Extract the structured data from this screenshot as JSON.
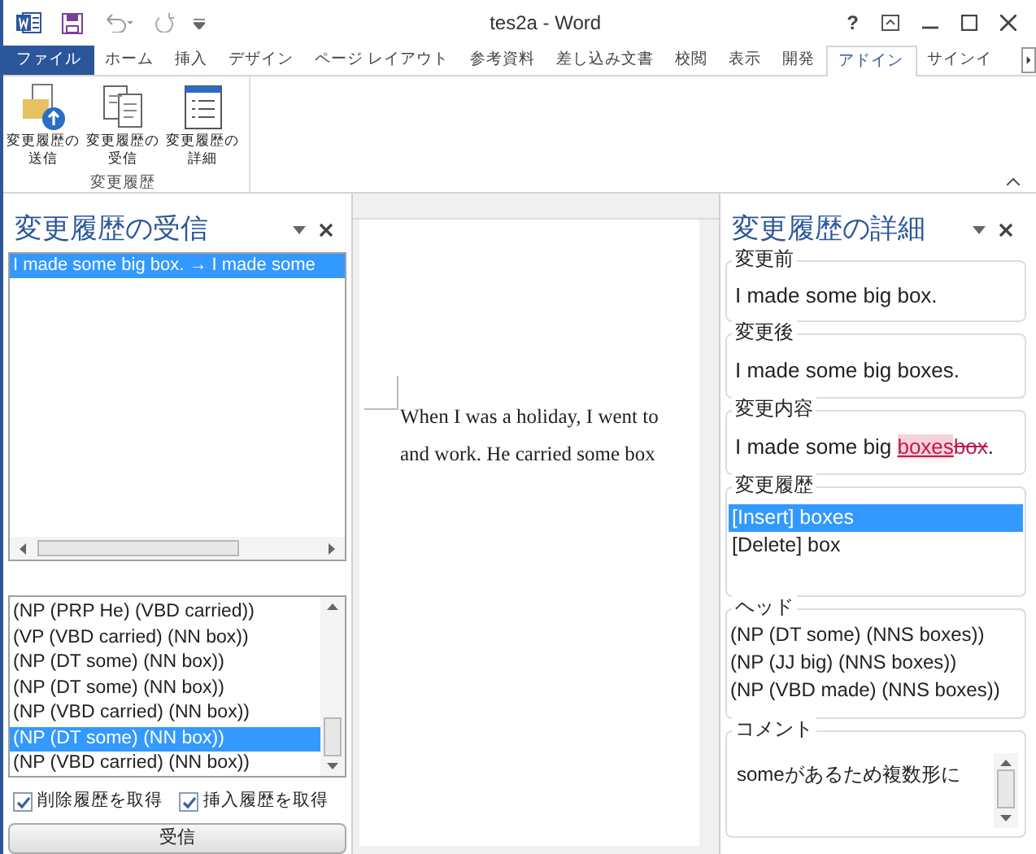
{
  "window": {
    "title": "tes2a - Word",
    "help": "?"
  },
  "ribbon_tabs": [
    {
      "label": "ファイル",
      "kind": "file",
      "selected": false
    },
    {
      "label": "ホーム",
      "kind": "tab",
      "selected": false
    },
    {
      "label": "挿入",
      "kind": "tab",
      "selected": false
    },
    {
      "label": "デザイン",
      "kind": "tab",
      "selected": false
    },
    {
      "label": "ページ レイアウト",
      "kind": "tab",
      "selected": false
    },
    {
      "label": "参考資料",
      "kind": "tab",
      "selected": false
    },
    {
      "label": "差し込み文書",
      "kind": "tab",
      "selected": false
    },
    {
      "label": "校閲",
      "kind": "tab",
      "selected": false
    },
    {
      "label": "表示",
      "kind": "tab",
      "selected": false
    },
    {
      "label": "開発",
      "kind": "tab",
      "selected": false
    },
    {
      "label": "アドイン",
      "kind": "tab",
      "selected": true
    },
    {
      "label": "サインイ",
      "kind": "tab",
      "selected": false
    }
  ],
  "ribbon_group": {
    "label": "変更履歴",
    "buttons": [
      {
        "lines": [
          "変更履歴の",
          "送信"
        ],
        "kind": "send"
      },
      {
        "lines": [
          "変更履歴の",
          "受信"
        ],
        "kind": "receive"
      },
      {
        "lines": [
          "変更履歴の",
          "詳細"
        ],
        "kind": "detail"
      }
    ]
  },
  "left_pane": {
    "title": "変更履歴の受信",
    "history_list": [
      {
        "text": "I made some big box. → I made some",
        "selected": true
      }
    ],
    "parse_list": [
      {
        "text": "(NP (PRP He) (VBD carried))",
        "selected": false
      },
      {
        "text": "(VP (VBD carried) (NN box))",
        "selected": false
      },
      {
        "text": "(NP (DT some) (NN box))",
        "selected": false
      },
      {
        "text": "(NP (DT some) (NN box))",
        "selected": false
      },
      {
        "text": "(NP (VBD carried) (NN box))",
        "selected": false
      },
      {
        "text": "(NP (DT some) (NN box))",
        "selected": true
      },
      {
        "text": "(NP (VBD carried) (NN box))",
        "selected": false
      }
    ],
    "checkboxes": [
      {
        "label": "削除履歴を取得",
        "checked": true
      },
      {
        "label": "挿入履歴を取得",
        "checked": true
      }
    ],
    "button": "受信"
  },
  "document": {
    "lines": [
      "When I was a holiday, I went to",
      "and work. He carried some box"
    ]
  },
  "right_pane": {
    "title": "変更履歴の詳細",
    "before": {
      "label": "変更前",
      "text": "I made some big box."
    },
    "after": {
      "label": "変更後",
      "text": "I made some big boxes."
    },
    "diff": {
      "label": "変更内容",
      "segments": [
        {
          "text": "I made some big ",
          "kind": "normal"
        },
        {
          "text": "boxes",
          "kind": "insert"
        },
        {
          "text": "box",
          "kind": "delete"
        },
        {
          "text": ".",
          "kind": "normal"
        }
      ]
    },
    "history": {
      "label": "変更履歴",
      "items": [
        {
          "text": "[Insert] boxes",
          "selected": true
        },
        {
          "text": "[Delete] box",
          "selected": false
        }
      ]
    },
    "head": {
      "label": "ヘッド",
      "lines": [
        "(NP (DT some) (NNS boxes))",
        "(NP (JJ big) (NNS boxes))",
        "(NP (VBD made) (NNS boxes))"
      ]
    },
    "comment": {
      "label": "コメント",
      "text": "someがあるため複数形に"
    }
  }
}
